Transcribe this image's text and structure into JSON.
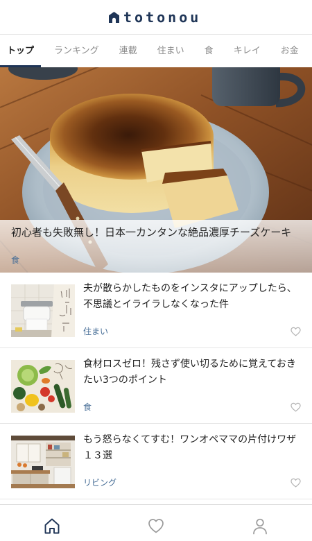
{
  "app": {
    "logo_text": "totonou",
    "logo_icon": "house-logo-icon",
    "brand_color": "#1f3557",
    "category_color": "#466d96"
  },
  "tabs": [
    {
      "label": "トップ",
      "active": true
    },
    {
      "label": "ランキング",
      "active": false
    },
    {
      "label": "連載",
      "active": false
    },
    {
      "label": "住まい",
      "active": false
    },
    {
      "label": "食",
      "active": false
    },
    {
      "label": "キレイ",
      "active": false
    },
    {
      "label": "お金",
      "active": false
    }
  ],
  "featured_article": {
    "title": "初心者も失敗無し！日本一カンタンな絶品濃厚チーズケーキ",
    "category": "食"
  },
  "articles": [
    {
      "title": "夫が散らかしたものをインスタにアップしたら、不思議とイライラしなくなった件",
      "category": "住まい",
      "favorite_icon": "heart-icon",
      "favorited": false
    },
    {
      "title": "食材ロスゼロ！残さず使い切るために覚えておきたい3つのポイント",
      "category": "食",
      "favorite_icon": "heart-icon",
      "favorited": false
    },
    {
      "title": "もう怒らなくてすむ！ワンオペママの片付けワザ１３選",
      "category": "リビング",
      "favorite_icon": "heart-icon",
      "favorited": false
    }
  ],
  "bottom_nav": [
    {
      "icon": "home-icon",
      "active": true
    },
    {
      "icon": "heart-icon",
      "active": false
    },
    {
      "icon": "person-icon",
      "active": false
    }
  ]
}
